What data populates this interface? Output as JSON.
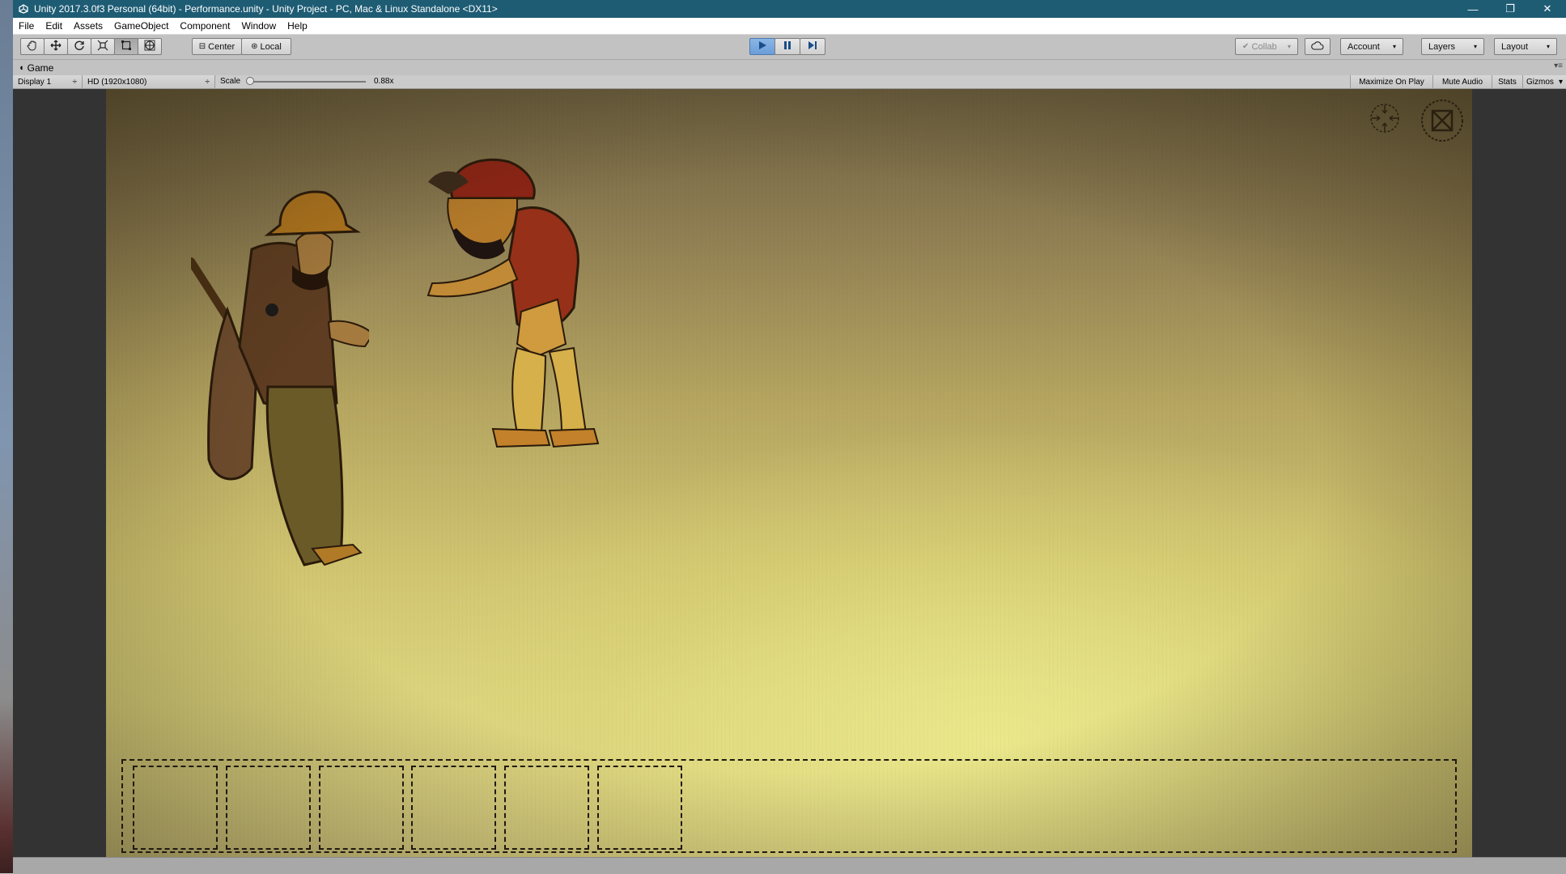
{
  "window": {
    "title": "Unity 2017.3.0f3 Personal (64bit) - Performance.unity - Unity Project - PC, Mac & Linux Standalone <DX11>",
    "app_icon": "unity-logo-icon",
    "controls": {
      "minimize": "—",
      "restore": "❐",
      "close": "✕"
    }
  },
  "menubar": {
    "items": [
      {
        "label": "File"
      },
      {
        "label": "Edit"
      },
      {
        "label": "Assets"
      },
      {
        "label": "GameObject"
      },
      {
        "label": "Component"
      },
      {
        "label": "Window"
      },
      {
        "label": "Help"
      }
    ]
  },
  "toolbar": {
    "transform_tools": [
      "hand-icon",
      "move-icon",
      "rotate-icon",
      "scale-icon",
      "rect-icon",
      "transform-icon"
    ],
    "pivot": {
      "label": "Center",
      "icon": "pivot-center-icon"
    },
    "space": {
      "label": "Local",
      "icon": "pivot-local-icon"
    },
    "playback": {
      "play": "play-icon",
      "pause": "pause-icon",
      "step": "step-icon"
    },
    "collab": {
      "label": "Collab",
      "caret": "▾"
    },
    "cloud": "cloud-icon",
    "account": {
      "label": "Account",
      "caret": "▾"
    },
    "layers": {
      "label": "Layers",
      "caret": "▾"
    },
    "layout": {
      "label": "Layout",
      "caret": "▾"
    }
  },
  "game_view": {
    "tab_label": "Game",
    "tab_icon": "game-pacman-icon",
    "display": {
      "label": "Display 1",
      "caret": "÷"
    },
    "resolution": {
      "label": "HD (1920x1080)",
      "caret": "÷"
    },
    "scale": {
      "label": "Scale",
      "value_text": "0.88x",
      "value": 0.88
    },
    "options": {
      "maximize": "Maximize On Play",
      "mute": "Mute Audio",
      "stats": "Stats",
      "gizmos": "Gizmos",
      "gizmos_caret": "▾"
    },
    "hud": {
      "recenter_icon": "crosshair-icon",
      "close_icon": "close-box-icon"
    },
    "inventory": {
      "slot_count": 6
    }
  },
  "colors": {
    "titlebar": "#1e5c74",
    "editor_bg": "#c2c2c2",
    "viewport_bg": "#333333",
    "play_active": "#6a9ed8"
  }
}
